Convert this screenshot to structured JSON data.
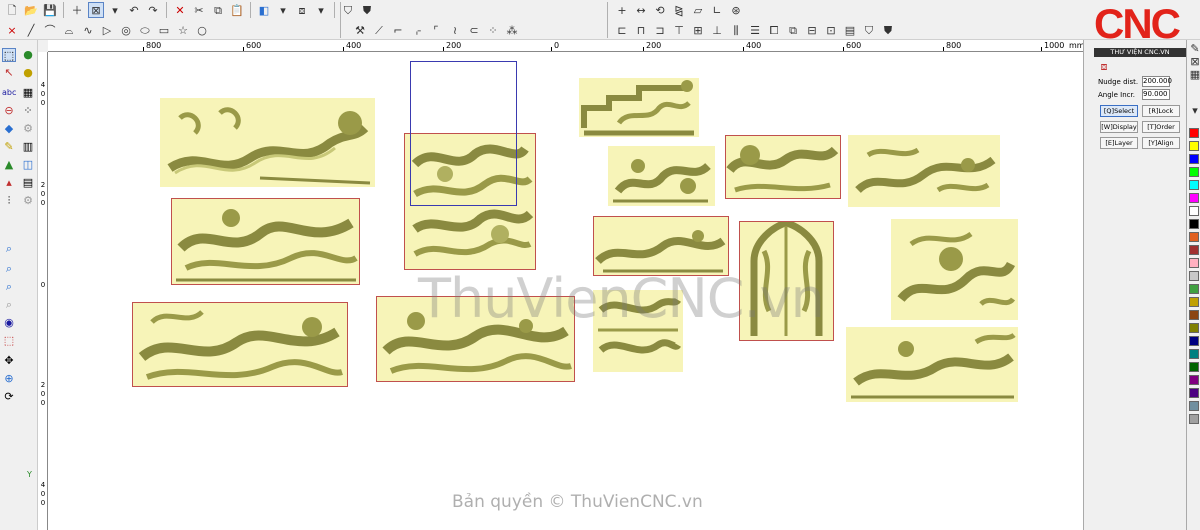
{
  "ruler": {
    "h_labels": [
      "800",
      "600",
      "400",
      "200",
      "0",
      "200",
      "400",
      "600",
      "800",
      "1000",
      "mm"
    ],
    "v_labels": [
      "4",
      "0",
      "0",
      "2",
      "0",
      "0",
      "0",
      "2",
      "0",
      "0",
      "4",
      "0",
      "0"
    ]
  },
  "watermark": "ThuVienCNC.vn",
  "copyright": "Bản quyền © ThuVienCNC.vn",
  "axis_label": "Y",
  "logo": {
    "text": "CNC",
    "subtitle": "THƯ VIỆN CNC.VN"
  },
  "props": {
    "nudge_label": "Nudge dist.",
    "nudge_value": "200.000",
    "angle_label": "Angle Incr.",
    "angle_value": "90.000"
  },
  "buttons": {
    "select": "[Q]Select",
    "lock": "[R]Lock",
    "display": "[W]Display",
    "order": "[T]Order",
    "layer": "[E]Layer",
    "align": "[Y]Align"
  },
  "palette": [
    "#ff0000",
    "#ffff00",
    "#0000ff",
    "#00ff00",
    "#00ffff",
    "#ff00ff",
    "#ffffff",
    "#000000",
    "#e06020",
    "#a03030",
    "#ffb0c0",
    "#c8c8c8",
    "#40a040",
    "#c0a000",
    "#8b4513",
    "#808000",
    "#000080",
    "#008080",
    "#006400",
    "#800080",
    "#4b0082",
    "#7090a0",
    "#a0a0a0"
  ],
  "colors": {
    "panel_fill": "#f7f4b8",
    "relief": "#a5a550",
    "outline": "#c0504d"
  }
}
